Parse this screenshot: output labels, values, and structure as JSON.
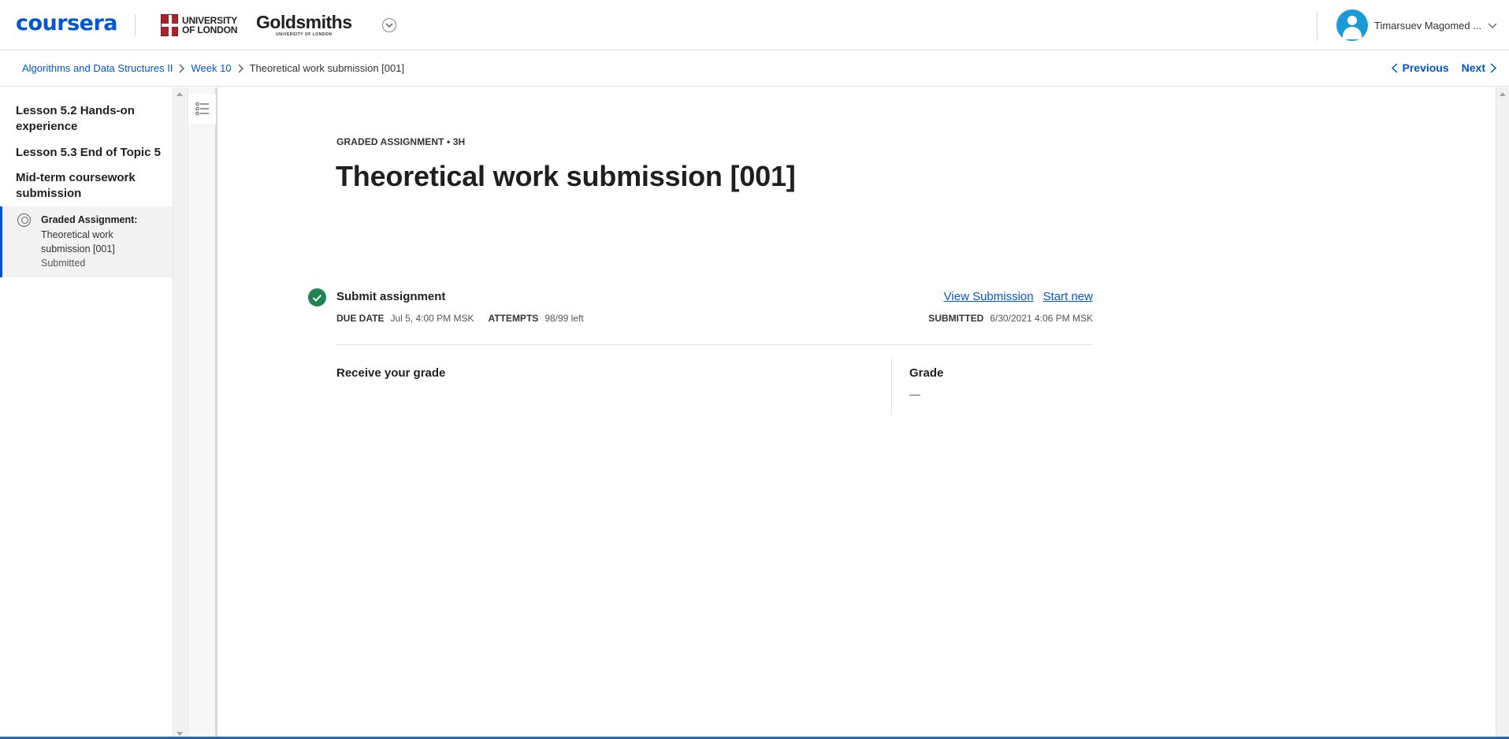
{
  "header": {
    "brand": "coursera",
    "partner1_line1": "UNIVERSITY",
    "partner1_line2": "OF LONDON",
    "partner2_main": "Goldsmiths",
    "partner2_sub": "UNIVERSITY OF LONDON",
    "user_name": "Timarsuev Magomed ..."
  },
  "breadcrumb": {
    "course": "Algorithms and Data Structures II",
    "week": "Week 10",
    "current": "Theoretical work submission [001]"
  },
  "nav": {
    "previous": "Previous",
    "next": "Next"
  },
  "sidebar": {
    "items": [
      {
        "label": "Lesson 5.2 Hands-on experience"
      },
      {
        "label": "Lesson 5.3 End of Topic 5"
      },
      {
        "label": "Mid-term coursework submission"
      }
    ],
    "active": {
      "type": "Graded Assignment:",
      "title": "Theoretical work submission [001]",
      "status": "Submitted"
    }
  },
  "assignment": {
    "eyebrow": "GRADED ASSIGNMENT • 3H",
    "title": "Theoretical work submission [001]",
    "submit_label": "Submit assignment",
    "due_key": "DUE DATE",
    "due_val": "Jul 5, 4:00 PM MSK",
    "attempts_key": "ATTEMPTS",
    "attempts_val": "98/99 left",
    "view_submission": "View Submission",
    "start_new": "Start new",
    "submitted_key": "SUBMITTED",
    "submitted_val": "6/30/2021 4:06 PM MSK",
    "receive_label": "Receive your grade",
    "grade_label": "Grade",
    "grade_value": "—"
  },
  "colors": {
    "brand_blue": "#0056d2",
    "success_green": "#1f8354",
    "avatar_blue": "#1a9bd7"
  },
  "icons": [
    "chevron-down-icon",
    "user-avatar-icon",
    "chevron-right-icon",
    "chevron-left-icon",
    "assignment-icon",
    "list-icon",
    "check-icon"
  ]
}
